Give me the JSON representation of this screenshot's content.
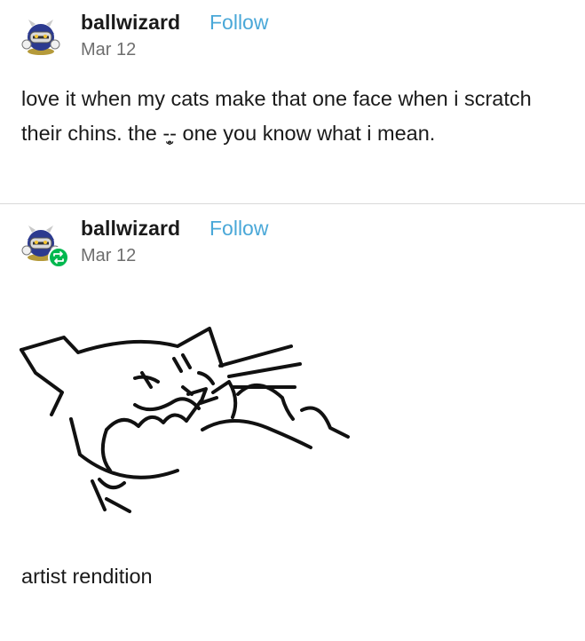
{
  "posts": [
    {
      "username": "ballwizard",
      "follow_label": "Follow",
      "date": "Mar 12",
      "text": "love it when my cats make that one face when i scratch their chins. the -̥̫- one you know what i mean."
    },
    {
      "username": "ballwizard",
      "follow_label": "Follow",
      "date": "Mar 12",
      "reblog_icon": "reblog-icon",
      "image_icon": "cat-drawing",
      "caption": "artist rendition"
    }
  ],
  "colors": {
    "follow": "#4aa8d8",
    "reblog": "#00b84f",
    "date": "#6e6e6e"
  }
}
